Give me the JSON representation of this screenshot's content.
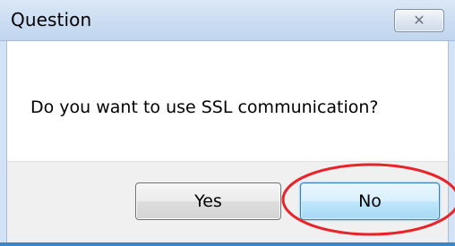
{
  "dialog": {
    "title": "Question",
    "message": "Do you want to use SSL communication?",
    "close_icon": "close-icon",
    "buttons": {
      "yes_label": "Yes",
      "no_label": "No"
    },
    "highlighted_button": "No"
  },
  "colors": {
    "titlebar": "#cadcf1",
    "footer": "#f0f0f0",
    "highlight_circle": "#e8242b",
    "default_button_border": "#3c7fb1"
  }
}
